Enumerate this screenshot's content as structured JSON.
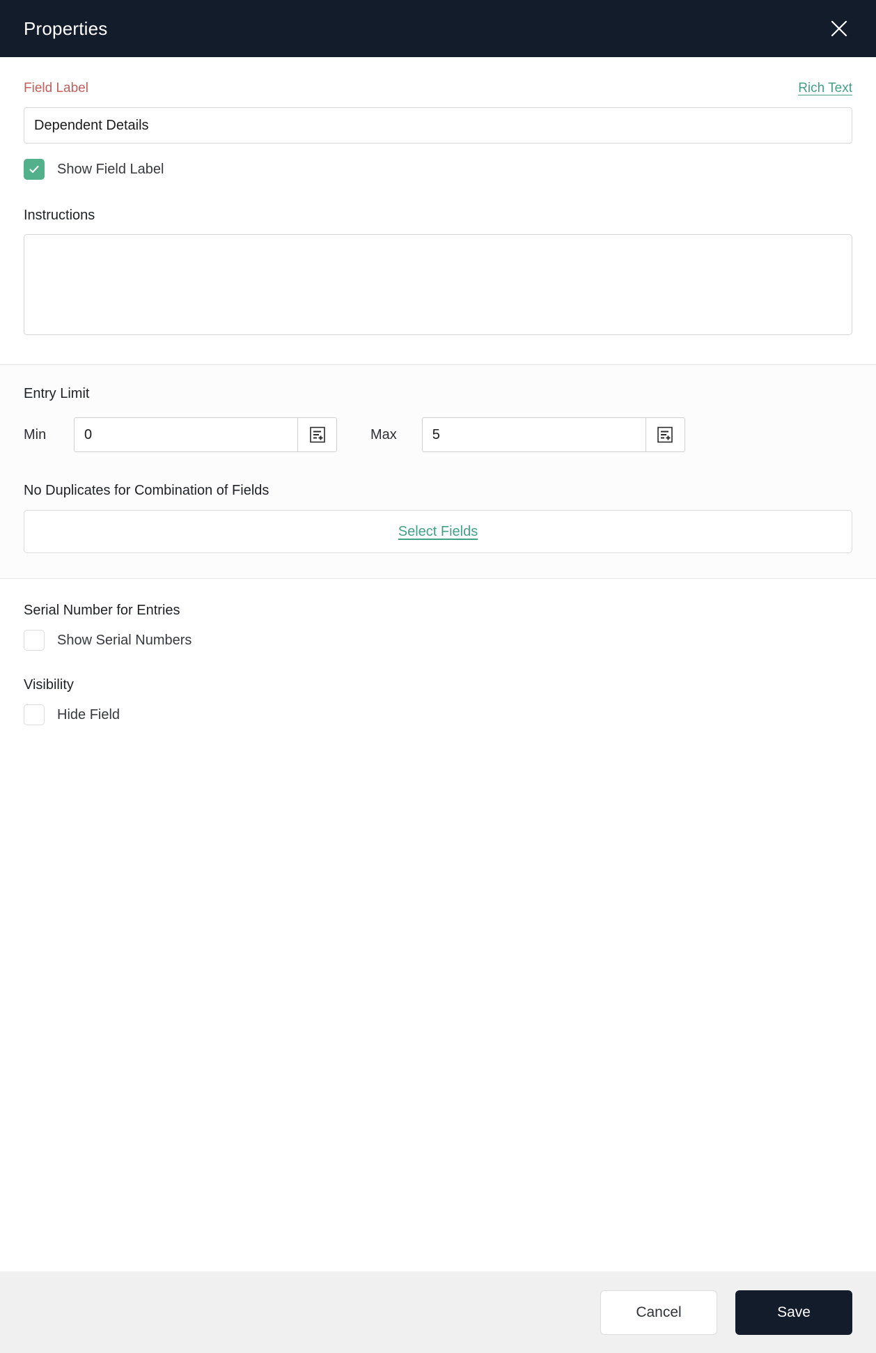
{
  "header": {
    "title": "Properties",
    "close_icon": "close-icon"
  },
  "field_label": {
    "caption": "Field Label",
    "rich_text_link": "Rich Text",
    "input_value": "Dependent Details",
    "input_placeholder": "",
    "show_field_label": {
      "label": "Show Field Label",
      "checked": true
    }
  },
  "instructions": {
    "heading": "Instructions",
    "value": "",
    "placeholder": ""
  },
  "entry_limit": {
    "heading": "Entry Limit",
    "min_label": "Min",
    "min_value": "0",
    "max_label": "Max",
    "max_value": "5",
    "stepper_icon": "form-insert-icon"
  },
  "no_duplicates": {
    "heading": "No Duplicates for Combination of Fields",
    "select_fields_label": "Select Fields"
  },
  "serial_number": {
    "heading": "Serial Number for Entries",
    "checkbox_label": "Show Serial Numbers",
    "checked": false
  },
  "visibility": {
    "heading": "Visibility",
    "checkbox_label": "Hide Field",
    "checked": false
  },
  "footer": {
    "cancel_label": "Cancel",
    "save_label": "Save"
  },
  "colors": {
    "header_bg": "#131c2b",
    "accent_green": "#43a283",
    "checkbox_green": "#52b08a",
    "required_red": "#c0605c",
    "footer_bg": "#f0f0f0",
    "shaded_section_bg": "#fcfcfc"
  }
}
